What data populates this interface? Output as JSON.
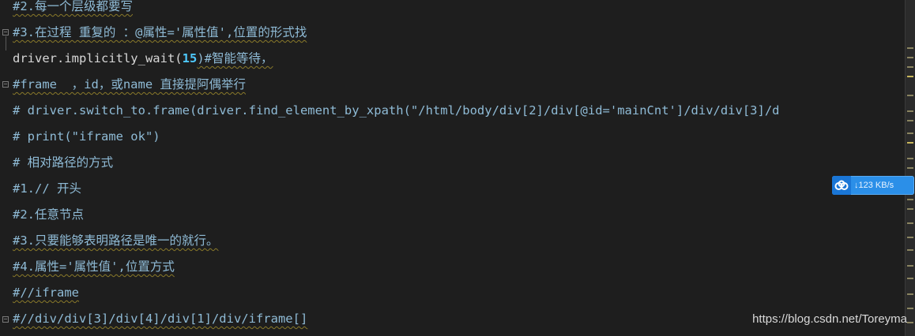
{
  "editor": {
    "lines": [
      {
        "text": "#2.每一个层级都要写"
      },
      {
        "text": "#3.在过程 重复的 ：@属性='属性值',位置的形式找"
      },
      {
        "text_before": "driver.implicitly_wait(",
        "number": "15",
        "text_after": ")#智能等待，"
      },
      {
        "text": "#frame  ，id，或name 直接提阿偶举行"
      },
      {
        "text": "# driver.switch_to.frame(driver.find_element_by_xpath(\"/html/body/div[2]/div[@id='mainCnt']/div/div[3]/d"
      },
      {
        "text": "# print(\"iframe ok\")"
      },
      {
        "text": "# 相对路径的方式"
      },
      {
        "text": "#1.// 开头"
      },
      {
        "text": "#2.任意节点"
      },
      {
        "text": "#3.只要能够表明路径是唯一的就行。"
      },
      {
        "text": "#4.属性='属性值',位置方式"
      },
      {
        "text": "#//iframe"
      },
      {
        "text": "#//div/div[3]/div[4]/div[1]/div/iframe[]"
      }
    ]
  },
  "net_widget": {
    "icon": "cloud-icon",
    "arrow": "↓",
    "speed": "123 KB/s"
  },
  "watermark": "https://blog.csdn.net/Toreyma",
  "colors": {
    "background": "#1e1e1e",
    "comment": "#8fbbd6",
    "code": "#d7d7d7",
    "number": "#4ec9ff",
    "widget": "#2b8fe8"
  }
}
